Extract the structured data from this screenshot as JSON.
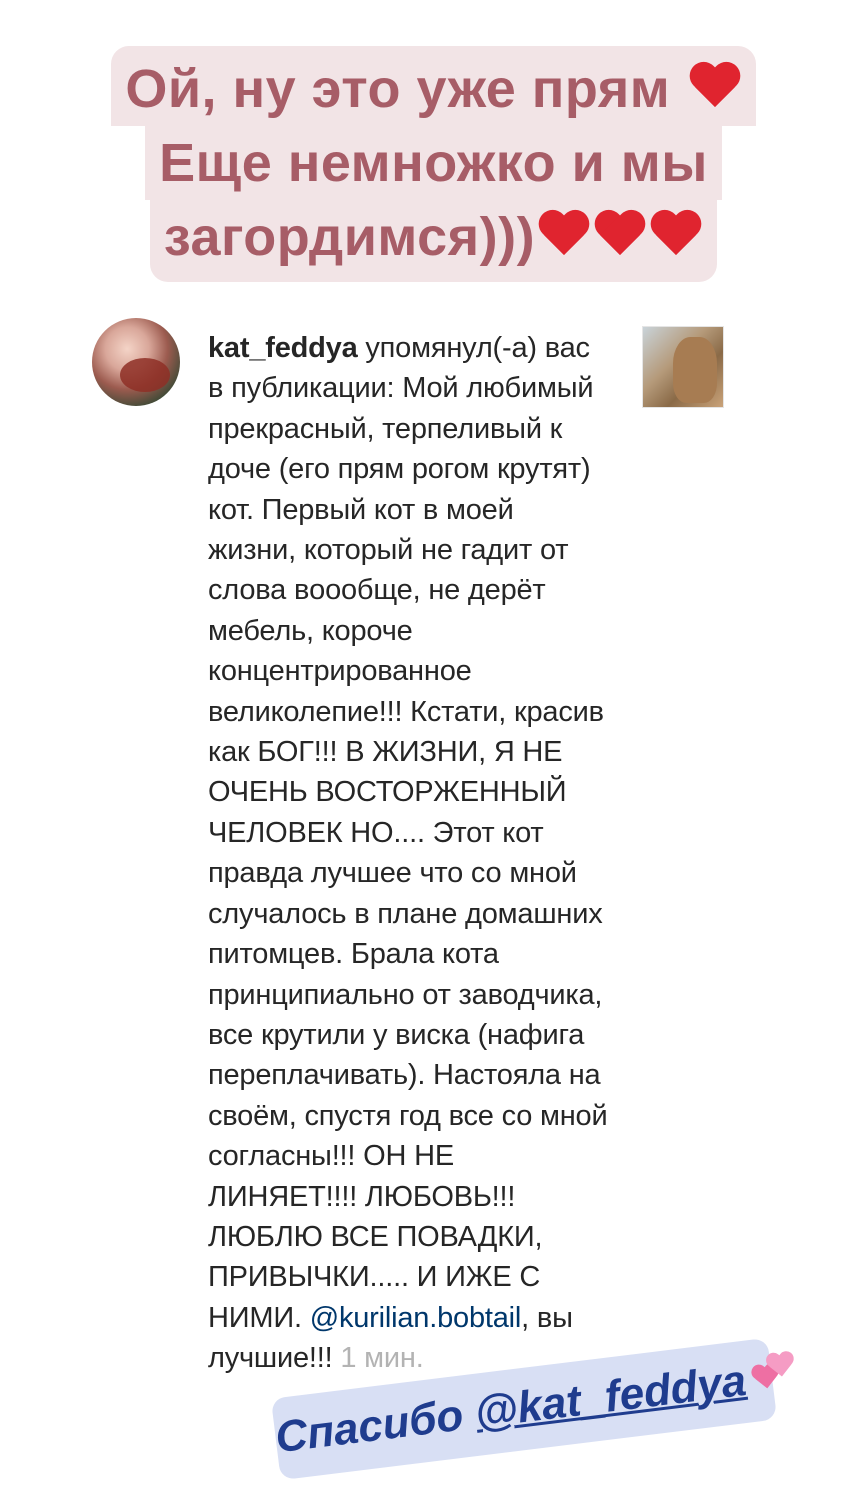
{
  "caption": {
    "line1": "Ой, ну это уже прям",
    "line2": "Еще немножко и мы",
    "line3": "загордимся)))",
    "heart_icon": "red-heart-icon",
    "heart_color": "#e0242f",
    "text_color": "#a75d67",
    "background_color": "#f2e4e6"
  },
  "notification": {
    "username": "kat_feddya",
    "action": "упомянул(-а) вас в публикации:",
    "body": "Мой любимый прекрасный, терпеливый к доче (его прям рогом крутят) кот. Первый кот в моей жизни, который не гадит от слова вooобще, не дерёт мебель, короче концентрированное великолепие!!! Кстати, красив как БОГ!!! В ЖИЗНИ, Я НЕ ОЧЕНЬ ВОСТОРЖЕННЫЙ ЧЕЛОВЕК  НО.... Этот кот правда лучшее что со мной случалось в плане домашних питомцев. Брала кота принципиально от заводчика, все крутили у виска (нафига переплачивать). Настояла на своём, спустя год все со мной согласны!!! ОН НЕ ЛИНЯЕТ!!!! ЛЮБОВЬ!!! ЛЮБЛЮ ВСЕ ПОВАДКИ, ПРИВЫЧКИ..... И ИЖЕ С НИМИ.",
    "mention": "@kurilian.bobtail",
    "ending": ", вы лучшие!!!",
    "time": "1 мин.",
    "mention_color": "#00376b"
  },
  "thanks_sticker": {
    "text": "Спасибо",
    "handle": "@kat_feddya",
    "icon": "two-hearts-icon",
    "text_color": "#1f3c8e",
    "background_color": "#d8dff4"
  }
}
